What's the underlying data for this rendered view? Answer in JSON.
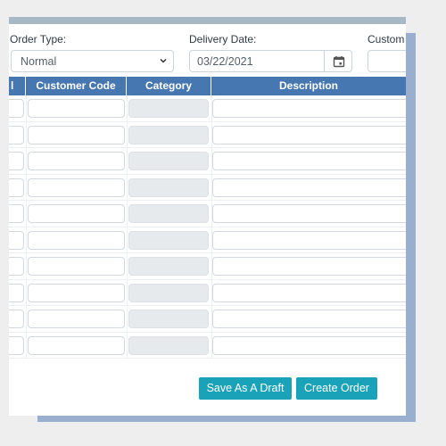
{
  "form": {
    "order_type": {
      "label": "Order Type:",
      "value": "Normal"
    },
    "delivery_date": {
      "label": "Delivery Date:",
      "value": "03/22/2021"
    },
    "customer": {
      "label": "Custom"
    }
  },
  "table": {
    "columns": [
      "l",
      "Customer Code",
      "Category",
      "Description"
    ],
    "row_count": 10
  },
  "actions": {
    "save_draft_label": "Save As A Draft",
    "create_order_label": "Create Order"
  },
  "colors": {
    "header_bg": "#4677b0",
    "button_bg": "#1aa2b8",
    "backdrop": "#9aaecf"
  }
}
